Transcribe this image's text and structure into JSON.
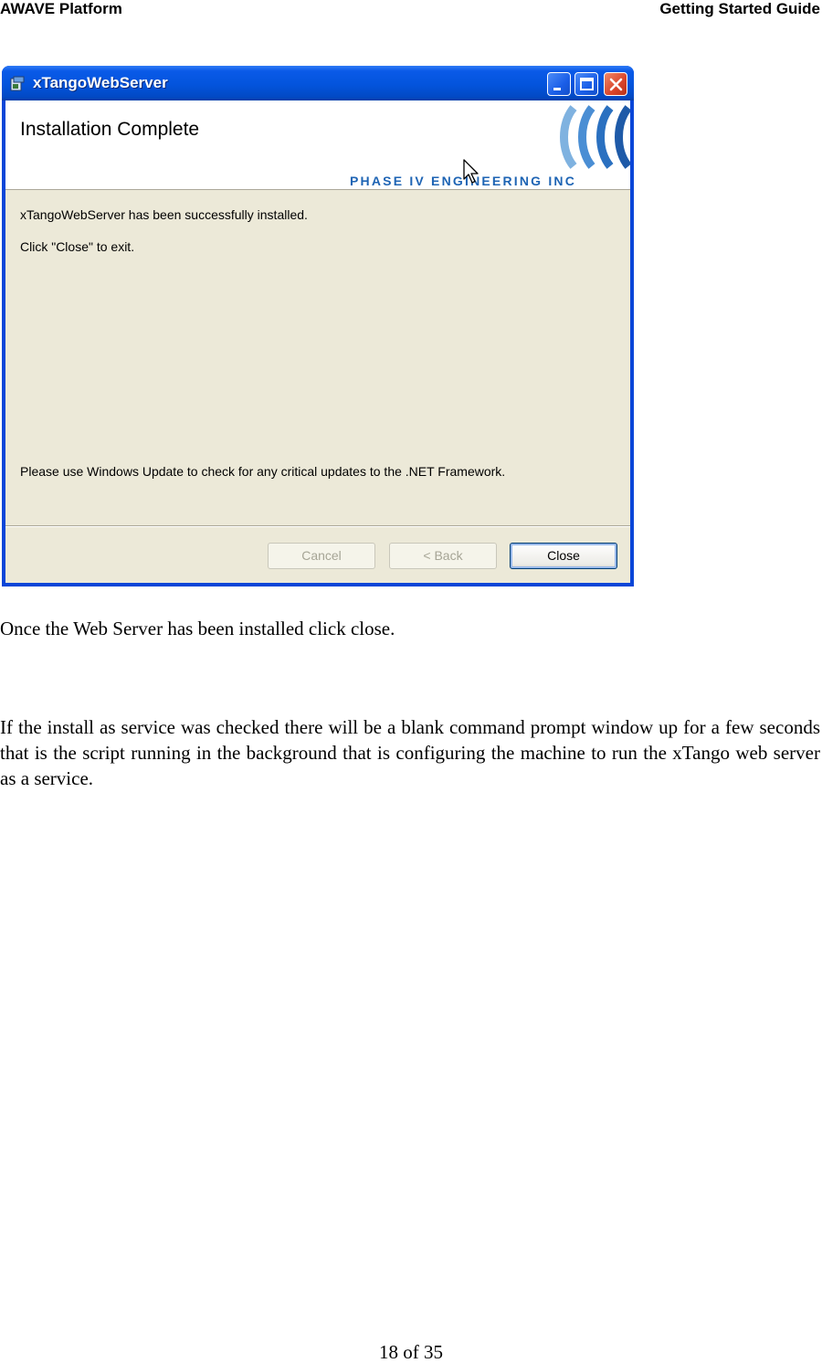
{
  "header": {
    "left": "AWAVE Platform",
    "right": "Getting Started Guide"
  },
  "window": {
    "title": "xTangoWebServer",
    "heading": "Installation Complete",
    "logo_text": "PHASE IV ENGINEERING INC",
    "message_1": "xTangoWebServer has been successfully installed.",
    "message_2": "Click \"Close\" to exit.",
    "message_3": "Please use Windows Update to check for any critical updates to the .NET Framework.",
    "buttons": {
      "cancel": "Cancel",
      "back": "< Back",
      "close": "Close"
    }
  },
  "body": {
    "paragraph_1": "Once the Web Server has been installed click close.",
    "paragraph_2": "If the install as service was checked there will be a blank command prompt window up for a few seconds that is the script running in the background that is configuring the machine to run the xTango web server as a service."
  },
  "footer": {
    "page": "18 of 35"
  }
}
